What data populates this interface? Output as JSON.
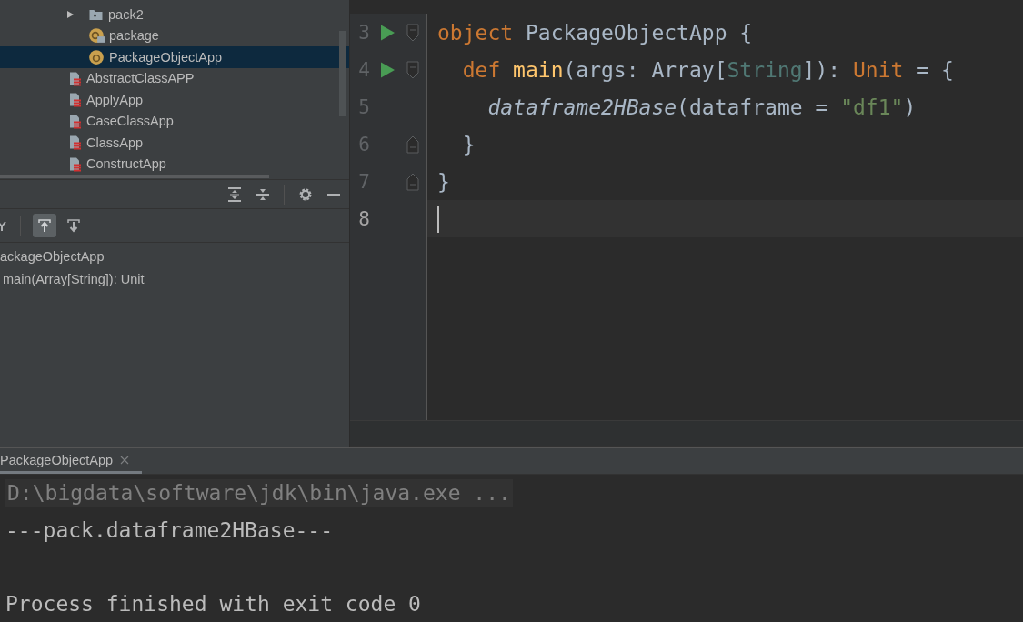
{
  "project_tree": [
    {
      "kind": "group",
      "children": [
        {
          "label": "pack2",
          "kind": "package",
          "expanded": false,
          "selected": false
        },
        {
          "label": "package",
          "kind": "package-object",
          "selected": false
        },
        {
          "label": "PackageObjectApp",
          "kind": "object",
          "selected": true
        }
      ]
    },
    {
      "label": "AbstractClassAPP",
      "kind": "scala-file",
      "selected": false
    },
    {
      "label": "ApplyApp",
      "kind": "scala-file",
      "selected": false
    },
    {
      "label": "CaseClassApp",
      "kind": "scala-file",
      "selected": false
    },
    {
      "label": "ClassApp",
      "kind": "scala-file",
      "selected": false
    },
    {
      "label": "ConstructApp",
      "kind": "scala-file",
      "selected": false
    }
  ],
  "structure": {
    "autoscroll_from_source": true,
    "autoscroll_to_source": false,
    "items": [
      {
        "label": "ackageObjectApp",
        "children": [
          {
            "label": "main(Array[String]): Unit"
          }
        ]
      }
    ]
  },
  "editor": {
    "lines": [
      {
        "number": "3",
        "run": true,
        "fold_start": true,
        "fold_end": false,
        "current": false,
        "tokens": [
          {
            "text": "object",
            "kind": "keyword"
          },
          {
            "text": " PackageObjectApp {",
            "kind": "plain"
          }
        ]
      },
      {
        "number": "4",
        "run": true,
        "fold_start": true,
        "fold_end": false,
        "current": false,
        "tokens": [
          {
            "text": "  def ",
            "kind": "keyword"
          },
          {
            "text": "main",
            "kind": "decl"
          },
          {
            "text": "(args: Array[",
            "kind": "plain"
          },
          {
            "text": "String",
            "kind": "type"
          },
          {
            "text": "]): ",
            "kind": "plain"
          },
          {
            "text": "Unit",
            "kind": "keyword"
          },
          {
            "text": " = {",
            "kind": "plain"
          }
        ]
      },
      {
        "number": "5",
        "run": false,
        "fold_start": false,
        "fold_end": false,
        "current": false,
        "tokens": [
          {
            "text": "    dataframe2HBase",
            "kind": "call"
          },
          {
            "text": "(dataframe = ",
            "kind": "plain"
          },
          {
            "text": "\"df1\"",
            "kind": "string"
          },
          {
            "text": ")",
            "kind": "plain"
          }
        ]
      },
      {
        "number": "6",
        "run": false,
        "fold_start": false,
        "fold_end": true,
        "current": false,
        "tokens": [
          {
            "text": "  }",
            "kind": "plain"
          }
        ]
      },
      {
        "number": "7",
        "run": false,
        "fold_start": false,
        "fold_end": true,
        "current": false,
        "tokens": [
          {
            "text": "}",
            "kind": "plain"
          }
        ]
      },
      {
        "number": "8",
        "run": false,
        "fold_start": false,
        "fold_end": false,
        "current": true
      }
    ]
  },
  "run_panel": {
    "tabs": [
      {
        "label": "PackageObjectApp",
        "selected": true
      }
    ],
    "console": [
      {
        "text": "D:\\bigdata\\software\\jdk\\bin\\java.exe ...",
        "kind": "command"
      },
      {
        "text": "---pack.dataframe2HBase---",
        "kind": "output"
      },
      {
        "kind": "blank"
      },
      {
        "text": "Process finished with exit code 0",
        "kind": "output"
      }
    ]
  }
}
